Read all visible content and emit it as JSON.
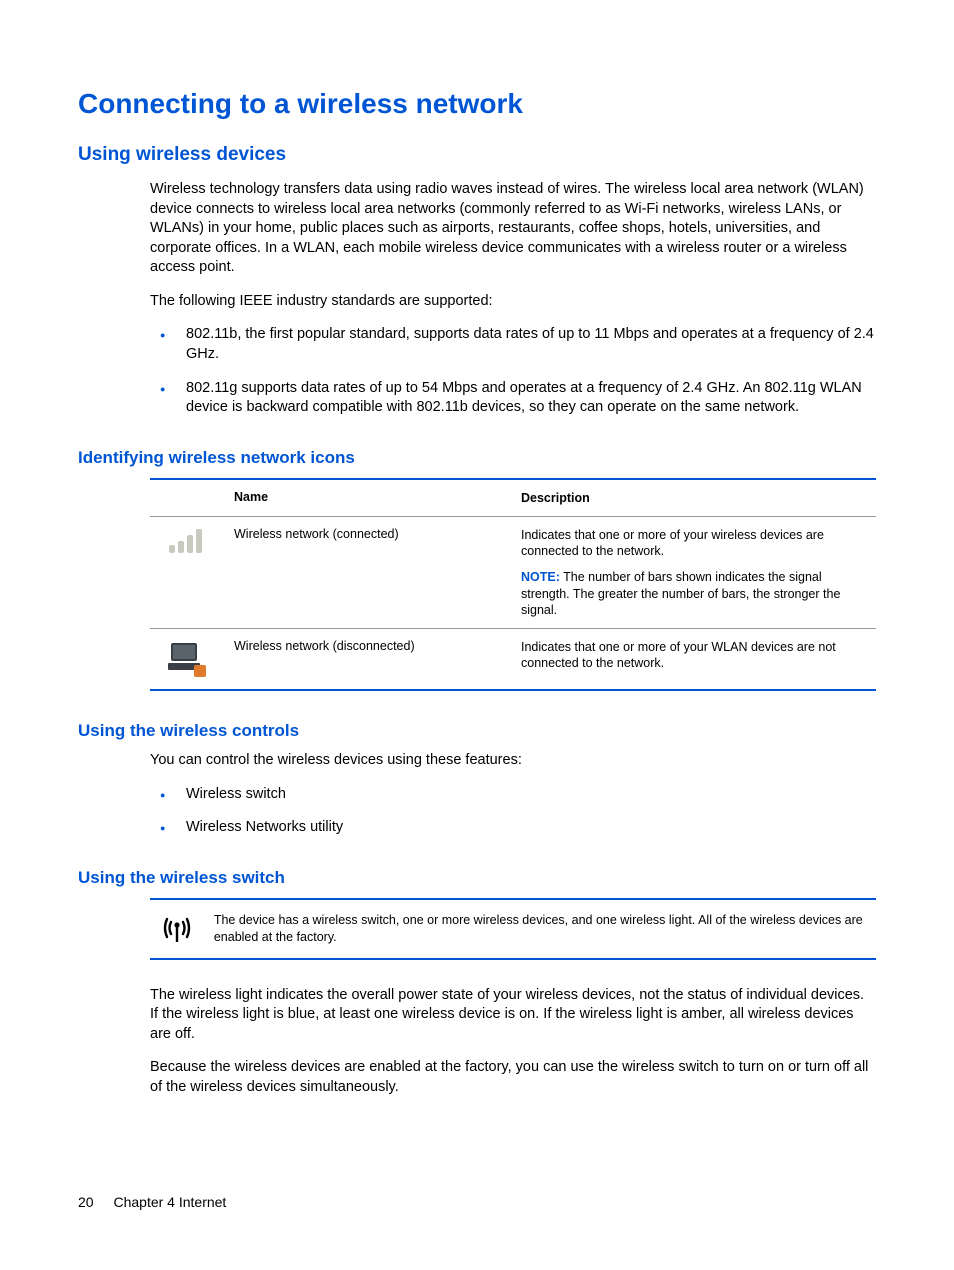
{
  "title": "Connecting to a wireless network",
  "section1": {
    "heading": "Using wireless devices",
    "para1": "Wireless technology transfers data using radio waves instead of wires. The wireless local area network (WLAN) device connects to wireless local area networks (commonly referred to as Wi-Fi networks, wireless LANs, or WLANs) in your home, public places such as airports, restaurants, coffee shops, hotels, universities, and corporate offices. In a WLAN, each mobile wireless device communicates with a wireless router or a wireless access point.",
    "para2": "The following IEEE industry standards are supported:",
    "bullets": [
      "802.11b, the first popular standard, supports data rates of up to 11 Mbps and operates at a frequency of 2.4 GHz.",
      "802.11g supports data rates of up to 54 Mbps and operates at a frequency of 2.4 GHz. An 802.11g WLAN device is backward compatible with 802.11b devices, so they can operate on the same network."
    ]
  },
  "section2": {
    "heading": "Identifying wireless network icons",
    "header_name": "Name",
    "header_desc": "Description",
    "rows": [
      {
        "name": "Wireless network (connected)",
        "desc": "Indicates that one or more of your wireless devices are connected to the network.",
        "note_label": "NOTE:",
        "note": "The number of bars shown indicates the signal strength. The greater the number of bars, the stronger the signal."
      },
      {
        "name": "Wireless network (disconnected)",
        "desc": "Indicates that one or more of your WLAN devices are not connected to the network."
      }
    ]
  },
  "section3": {
    "heading": "Using the wireless controls",
    "para": "You can control the wireless devices using these features:",
    "bullets": [
      "Wireless switch",
      "Wireless Networks utility"
    ]
  },
  "section4": {
    "heading": "Using the wireless switch",
    "callout": "The device has a wireless switch, one or more wireless devices, and one wireless light. All of the wireless devices are enabled at the factory.",
    "para1": "The wireless light indicates the overall power state of your wireless devices, not the status of individual devices. If the wireless light is blue, at least one wireless device is on. If the wireless light is amber, all wireless devices are off.",
    "para2": "Because the wireless devices are enabled at the factory, you can use the wireless switch to turn on or turn off all of the wireless devices simultaneously."
  },
  "footer": {
    "page": "20",
    "chapter": "Chapter 4   Internet"
  }
}
